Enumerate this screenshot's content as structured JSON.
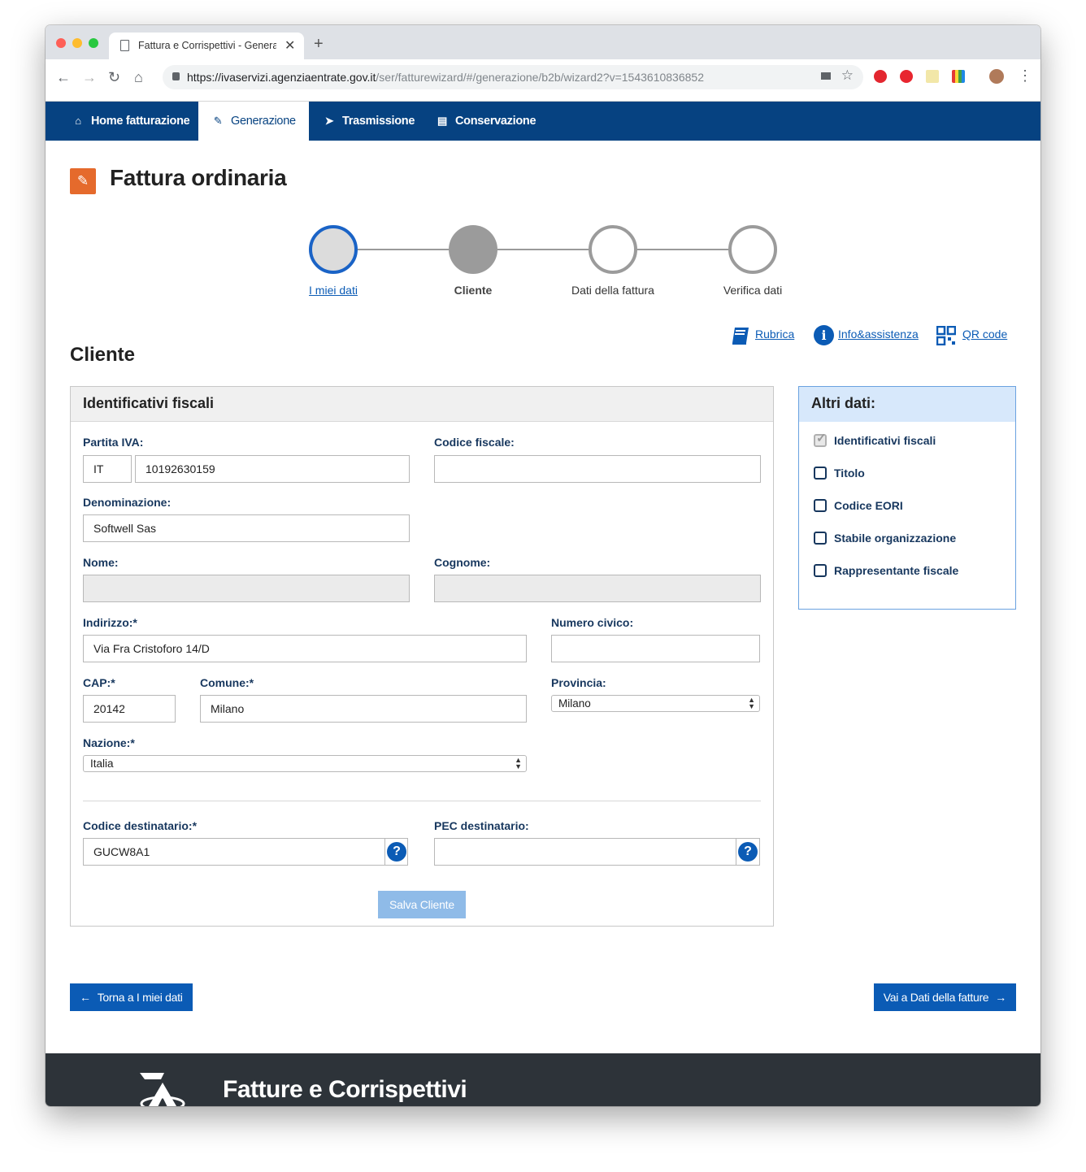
{
  "browser": {
    "tab_title": "Fattura e Corrispettivi - Genera",
    "url_host": "https://ivaservizi.agenziaentrate.gov.it",
    "url_path": "/ser/fatturewizard/#/generazione/b2b/wizard2?v=1543610836852"
  },
  "nav": {
    "items": [
      {
        "label": "Home fatturazione",
        "icon": "home-icon"
      },
      {
        "label": "Generazione",
        "icon": "pencil-icon"
      },
      {
        "label": "Trasmissione",
        "icon": "paper-plane-icon"
      },
      {
        "label": "Conservazione",
        "icon": "archive-icon"
      }
    ],
    "active_index": 1
  },
  "page": {
    "title": "Fattura ordinaria",
    "steps": [
      {
        "label": "I miei dati",
        "state": "current"
      },
      {
        "label": "Cliente",
        "state": "filled"
      },
      {
        "label": "Dati della fattura",
        "state": "todo"
      },
      {
        "label": "Verifica dati",
        "state": "todo"
      }
    ],
    "links": {
      "rubrica": "Rubrica",
      "info": "Info&assistenza",
      "qr": "QR code"
    },
    "section_title": "Cliente"
  },
  "form": {
    "panel_title": "Identificativi fiscali",
    "partita_iva_label": "Partita IVA:",
    "partita_iva_country": "IT",
    "partita_iva_value": "10192630159",
    "codice_fiscale_label": "Codice fiscale:",
    "codice_fiscale_value": "",
    "denominazione_label": "Denominazione:",
    "denominazione_value": "Softwell Sas",
    "nome_label": "Nome:",
    "cognome_label": "Cognome:",
    "indirizzo_label": "Indirizzo:*",
    "indirizzo_value": "Via Fra Cristoforo 14/D",
    "numero_civico_label": "Numero civico:",
    "cap_label": "CAP:*",
    "cap_value": "20142",
    "comune_label": "Comune:*",
    "comune_value": "Milano",
    "provincia_label": "Provincia:",
    "provincia_value": "Milano",
    "nazione_label": "Nazione:*",
    "nazione_value": "Italia",
    "codice_destinatario_label": "Codice destinatario:*",
    "codice_destinatario_value": "GUCW8A1",
    "pec_label": "PEC destinatario:",
    "save_button": "Salva Cliente"
  },
  "side": {
    "title": "Altri dati:",
    "options": [
      {
        "label": "Identificativi fiscali",
        "checked": true
      },
      {
        "label": "Titolo",
        "checked": false
      },
      {
        "label": "Codice EORI",
        "checked": false
      },
      {
        "label": "Stabile organizzazione",
        "checked": false
      },
      {
        "label": "Rappresentante fiscale",
        "checked": false
      }
    ]
  },
  "bottom": {
    "back_button": "Torna a I miei dati",
    "next_button": "Vai a Dati della fatture"
  },
  "footer": {
    "title": "Fatture e Corrispettivi"
  },
  "colors": {
    "nav_bg": "#064281",
    "accent": "#0b5bb5",
    "title_icon": "#e56a2c",
    "footer_bg": "#2d3339"
  }
}
